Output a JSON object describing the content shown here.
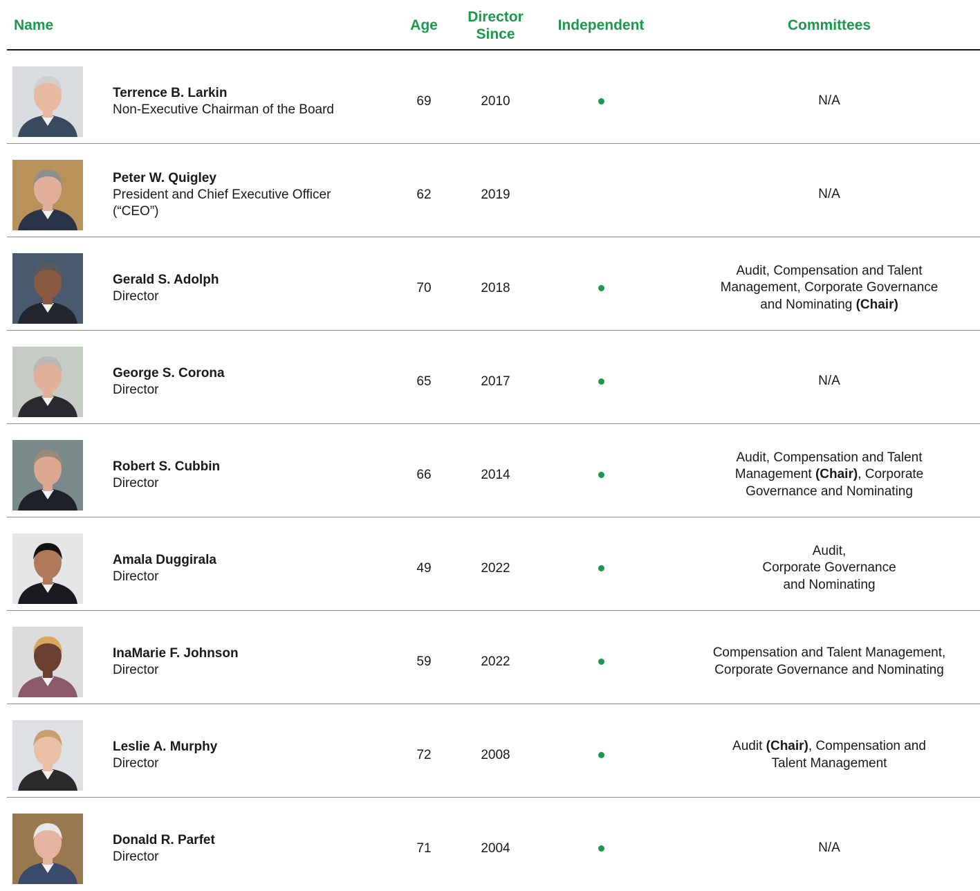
{
  "header": {
    "name": "Name",
    "age": "Age",
    "director_since_line1": "Director",
    "director_since_line2": "Since",
    "independent": "Independent",
    "committees": "Committees"
  },
  "colors": {
    "accent": "#1a9a4a",
    "rule": "#1a1a1a"
  },
  "directors": [
    {
      "name": "Terrence B. Larkin",
      "title": "Non-Executive Chairman of the Board",
      "age": "69",
      "since": "2010",
      "independent": true,
      "committees": [
        {
          "t": "N/A"
        }
      ],
      "photo": {
        "bg": "#d9dde0",
        "suit": "#3a4a5e",
        "skin": "#e6b8a0",
        "hair": "#cfcfcf"
      }
    },
    {
      "name": "Peter W. Quigley",
      "title": "President and Chief Executive Officer (“CEO”)",
      "age": "62",
      "since": "2019",
      "independent": false,
      "committees": [
        {
          "t": "N/A"
        }
      ],
      "photo": {
        "bg": "#b8925a",
        "suit": "#2a3348",
        "skin": "#e2b09a",
        "hair": "#8e8e8e"
      }
    },
    {
      "name": "Gerald S. Adolph",
      "title": "Director",
      "age": "70",
      "since": "2018",
      "independent": true,
      "committees": [
        {
          "t": "Audit, Compensation and Talent Management, Corporate Governance and Nominating "
        },
        {
          "t": "(Chair)",
          "b": true
        }
      ],
      "photo": {
        "bg": "#4a5a6e",
        "suit": "#22262e",
        "skin": "#8a5a42",
        "hair": "#5a5a5a"
      }
    },
    {
      "name": "George S. Corona",
      "title": "Director",
      "age": "65",
      "since": "2017",
      "independent": true,
      "committees": [
        {
          "t": "N/A"
        }
      ],
      "photo": {
        "bg": "#c4ccc4",
        "suit": "#2a2a2e",
        "skin": "#e0b09a",
        "hair": "#b8b8b8"
      }
    },
    {
      "name": "Robert S. Cubbin",
      "title": "Director",
      "age": "66",
      "since": "2014",
      "independent": true,
      "committees": [
        {
          "t": "Audit, Compensation and Talent Management "
        },
        {
          "t": "(Chair)",
          "b": true
        },
        {
          "t": ", Corporate Governance and Nominating"
        }
      ],
      "photo": {
        "bg": "#7a8a8a",
        "suit": "#1e2228",
        "skin": "#dca890",
        "hair": "#9a8a7a"
      }
    },
    {
      "name": "Amala Duggirala",
      "title": "Director",
      "age": "49",
      "since": "2022",
      "independent": true,
      "committees": [
        {
          "t": "Audit,\nCorporate Governance\nand Nominating"
        }
      ],
      "photo": {
        "bg": "#e4e6e8",
        "suit": "#1a1a1e",
        "skin": "#b07a5a",
        "hair": "#121212"
      }
    },
    {
      "name": "InaMarie F. Johnson",
      "title": "Director",
      "age": "59",
      "since": "2022",
      "independent": true,
      "committees": [
        {
          "t": "Compensation and Talent Management, Corporate Governance and Nominating"
        }
      ],
      "photo": {
        "bg": "#dcdcdc",
        "suit": "#8a5a6a",
        "skin": "#6a4030",
        "hair": "#d8a860"
      }
    },
    {
      "name": "Leslie A. Murphy",
      "title": "Director",
      "age": "72",
      "since": "2008",
      "independent": true,
      "committees": [
        {
          "t": "Audit "
        },
        {
          "t": "(Chair)",
          "b": true
        },
        {
          "t": ", Compensation and Talent Management"
        }
      ],
      "photo": {
        "bg": "#dfe2e4",
        "suit": "#2a2a2a",
        "skin": "#e8c0a8",
        "hair": "#c8a070"
      }
    },
    {
      "name": "Donald R. Parfet",
      "title": "Director",
      "age": "71",
      "since": "2004",
      "independent": true,
      "committees": [
        {
          "t": "N/A"
        }
      ],
      "photo": {
        "bg": "#9a7850",
        "suit": "#3a4a6a",
        "skin": "#e4b4a0",
        "hair": "#e8e8e8"
      }
    }
  ]
}
